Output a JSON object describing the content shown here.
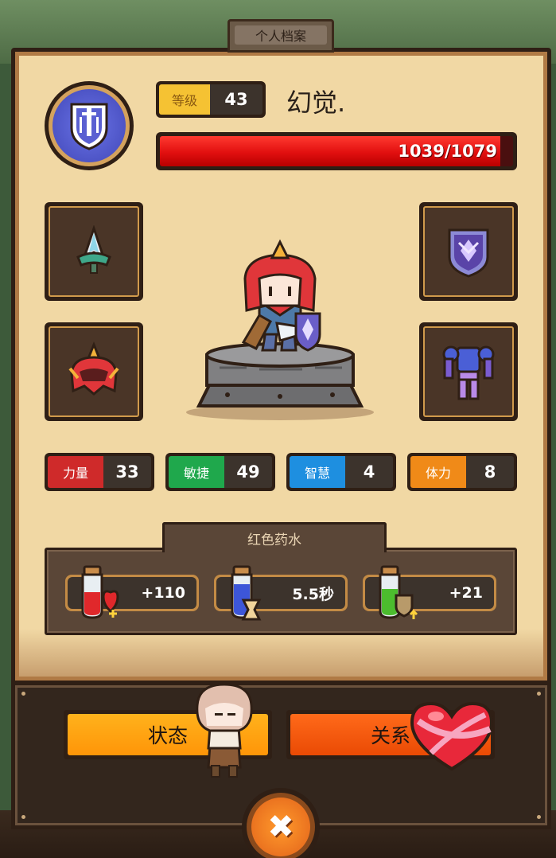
{
  "header": {
    "title": "个人档案"
  },
  "profile": {
    "level_label": "等级",
    "level": "43",
    "name": "幻觉.",
    "hp_text": "1039/1079",
    "hp_current": 1039,
    "hp_max": 1079
  },
  "equipment": [
    {
      "slot": "top-left",
      "icon": "spear-tip-icon"
    },
    {
      "slot": "top-right",
      "icon": "purple-shield-icon"
    },
    {
      "slot": "bottom-left",
      "icon": "red-helmet-icon"
    },
    {
      "slot": "bottom-right",
      "icon": "purple-armor-icon"
    }
  ],
  "stats": [
    {
      "label": "力量",
      "value": "33",
      "color": "#cf2a2a"
    },
    {
      "label": "敏捷",
      "value": "49",
      "color": "#1fa84c"
    },
    {
      "label": "智慧",
      "value": "4",
      "color": "#1e8fe0"
    },
    {
      "label": "体力",
      "value": "8",
      "color": "#f08a18"
    }
  ],
  "potion": {
    "title": "红色药水",
    "items": [
      {
        "value": "+110",
        "icon": "heart-potion-icon"
      },
      {
        "value": "5.5秒",
        "icon": "hourglass-potion-icon"
      },
      {
        "value": "+21",
        "icon": "armor-potion-icon"
      }
    ]
  },
  "actions": {
    "status_label": "状态",
    "relations_label": "关系",
    "status_color": "#ffa010",
    "relations_color": "#f55a0a"
  }
}
